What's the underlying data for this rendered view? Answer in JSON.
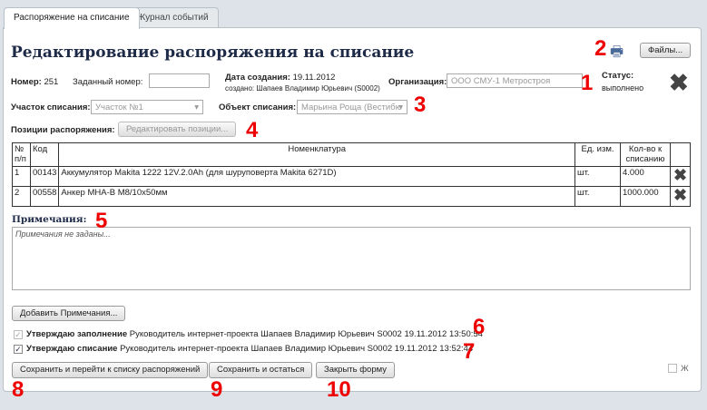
{
  "tabs": [
    {
      "label": "Распоряжение на списание"
    },
    {
      "label": "Журнал событий"
    }
  ],
  "title": "Редактирование распоряжения на списание",
  "files_button": "Файлы...",
  "number": {
    "label": "Номер:",
    "value": "251"
  },
  "given_number": {
    "label": "Заданный номер:",
    "value": ""
  },
  "created": {
    "label": "Дата создания:",
    "value": "19.11.2012",
    "by": "создано: Шапаев Владимир Юрьевич (S0002)"
  },
  "organization": {
    "label": "Организация:",
    "value": "ООО СМУ-1 Метростроя"
  },
  "status": {
    "label": "Статус:",
    "value": "выполнено"
  },
  "site": {
    "label": "Участок списания:",
    "value": "Участок №1"
  },
  "object": {
    "label": "Объект списания:",
    "value": "Марьина Роща (Вестибю"
  },
  "positions": {
    "label": "Позиции распоряжения:",
    "button": "Редактировать позиции..."
  },
  "table": {
    "headers": [
      "№ п/п",
      "Код",
      "Номенклатура",
      "Ед. изм.",
      "Кол-во к списанию"
    ],
    "rows": [
      {
        "n": "1",
        "code": "00143",
        "name": "Аккумулятор Makita 1222 12V.2.0Ah (для шуруповерта Makita 6271D)",
        "unit": "шт.",
        "qty": "4.000"
      },
      {
        "n": "2",
        "code": "00558",
        "name": "Анкер МНА-В М8/10х50мм",
        "unit": "шт.",
        "qty": "1000.000"
      }
    ]
  },
  "notes": {
    "label": "Примечания:",
    "value": "Примечания не заданы...",
    "add_button": "Добавить Примечания..."
  },
  "approvals": [
    {
      "checked": true,
      "disabled": true,
      "label": "Утверждаю заполнение",
      "text": "Руководитель интернет-проекта Шапаев Владимир Юрьевич S0002 19.11.2012 13:50:54"
    },
    {
      "checked": true,
      "disabled": false,
      "label": "Утверждаю списание",
      "text": "Руководитель интернет-проекта Шапаев Владимир Юрьевич S0002 19.11.2012 13:52:44"
    }
  ],
  "buttons": {
    "save_go": "Сохранить и перейти к списку распоряжений",
    "save_stay": "Сохранить и остаться",
    "close": "Закрыть форму"
  },
  "bold_toggle": {
    "label": "Ж",
    "checked": false
  },
  "annotations": [
    "1",
    "2",
    "3",
    "4",
    "5",
    "6",
    "7",
    "8",
    "9",
    "10"
  ],
  "colors": {
    "annotation": "#e00000",
    "title": "#1d2a48"
  }
}
